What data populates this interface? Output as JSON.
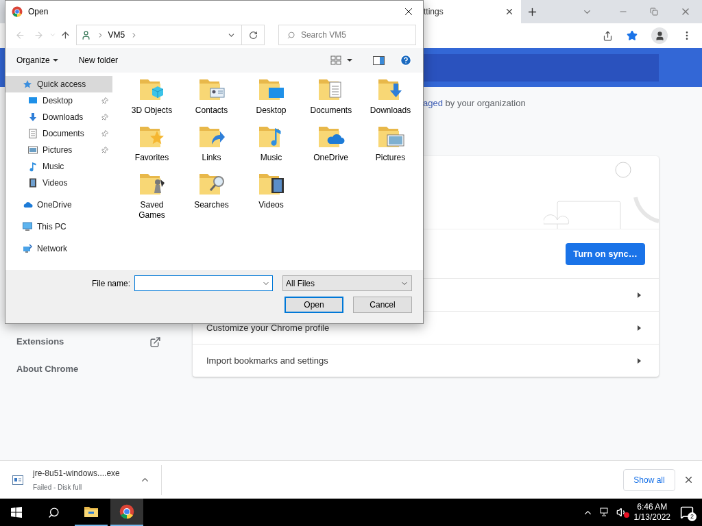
{
  "browser": {
    "tab_title": "ttings",
    "managed_notice": {
      "link": "aged",
      "text": "by your organization"
    },
    "sync_button": "Turn on sync…",
    "rows": [
      "Customize your Chrome profile",
      "Import bookmarks and settings"
    ],
    "nav": [
      {
        "label": "Extensions",
        "external": true
      },
      {
        "label": "About Chrome",
        "external": false
      }
    ]
  },
  "dialog": {
    "title": "Open",
    "breadcrumb": [
      "VM5"
    ],
    "search": {
      "placeholder": "Search VM5"
    },
    "organize": "Organize",
    "new_folder": "New folder",
    "nav_pane": [
      {
        "label": "Quick access",
        "kind": "star",
        "selected": true,
        "children": [
          {
            "label": "Desktop",
            "kind": "desktop",
            "pinned": true,
            "selected": false
          },
          {
            "label": "Downloads",
            "kind": "download",
            "pinned": true,
            "selected": false
          },
          {
            "label": "Documents",
            "kind": "document",
            "pinned": true,
            "selected": false
          },
          {
            "label": "Pictures",
            "kind": "picture",
            "pinned": true,
            "selected": false
          },
          {
            "label": "Music",
            "kind": "music",
            "pinned": false,
            "selected": false
          },
          {
            "label": "Videos",
            "kind": "video",
            "pinned": false,
            "selected": false
          }
        ]
      },
      {
        "label": "OneDrive",
        "kind": "cloud",
        "selected": false
      },
      {
        "label": "This PC",
        "kind": "pc",
        "selected": false
      },
      {
        "label": "Network",
        "kind": "network",
        "selected": false
      }
    ],
    "folders": [
      {
        "label": "3D Objects",
        "kind": "cube"
      },
      {
        "label": "Contacts",
        "kind": "contacts"
      },
      {
        "label": "Desktop",
        "kind": "desktop"
      },
      {
        "label": "Documents",
        "kind": "document"
      },
      {
        "label": "Downloads",
        "kind": "download"
      },
      {
        "label": "Favorites",
        "kind": "star"
      },
      {
        "label": "Links",
        "kind": "link"
      },
      {
        "label": "Music",
        "kind": "music"
      },
      {
        "label": "OneDrive",
        "kind": "cloud"
      },
      {
        "label": "Pictures",
        "kind": "picture"
      },
      {
        "label": "Saved Games",
        "kind": "game"
      },
      {
        "label": "Searches",
        "kind": "search"
      },
      {
        "label": "Videos",
        "kind": "video"
      }
    ],
    "file_name_label": "File name:",
    "file_type": "All Files",
    "buttons": [
      {
        "label": "Open",
        "default": true
      },
      {
        "label": "Cancel",
        "default": false
      }
    ]
  },
  "download": {
    "filename": "jre-8u51-windows....exe",
    "status": "Failed - Disk full",
    "show_all": "Show all"
  },
  "taskbar": {
    "time": "6:46 AM",
    "date": "1/13/2022",
    "notifications": "2"
  }
}
